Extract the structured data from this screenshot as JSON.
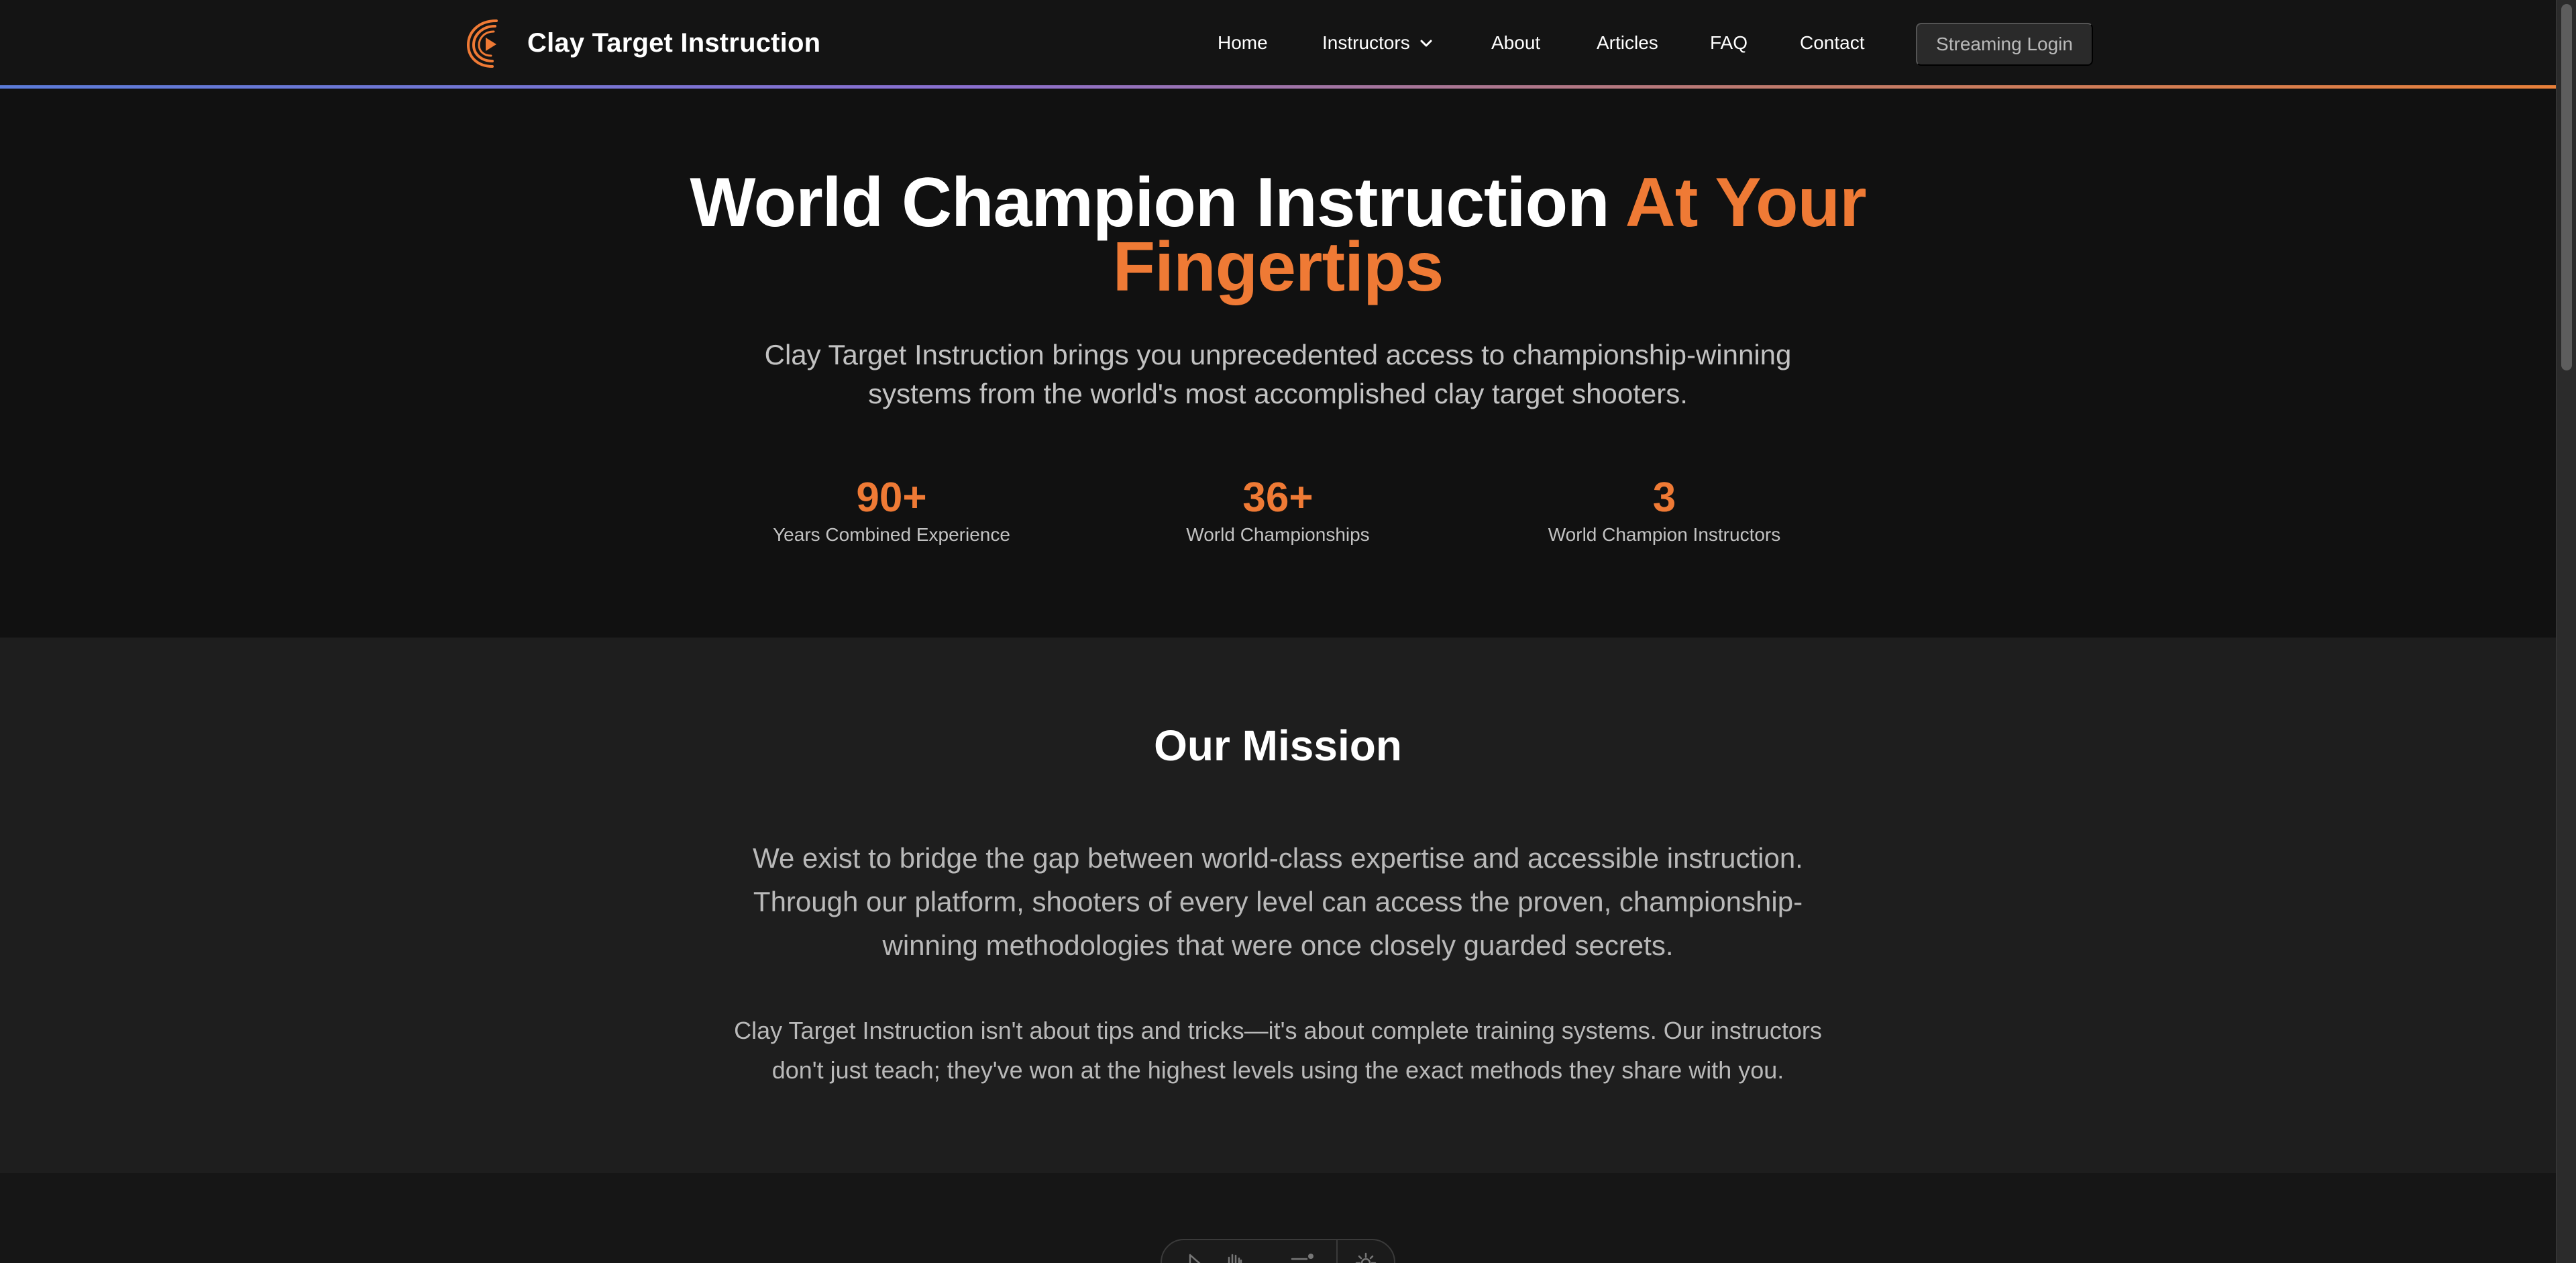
{
  "brand": {
    "name": "Clay Target Instruction",
    "logo_icon": "play-swoosh-logo",
    "accent_color": "#ef7a35"
  },
  "nav": {
    "items": [
      {
        "label": "Home"
      },
      {
        "label": "Instructors",
        "icon": "chevron-down-icon"
      },
      {
        "label": "About"
      },
      {
        "label": "Articles"
      },
      {
        "label": "FAQ"
      },
      {
        "label": "Contact"
      }
    ],
    "login_label": "Streaming Login"
  },
  "hero": {
    "title_white": "World Champion Instruction ",
    "title_orange_1": "At Your",
    "title_orange_2": "Fingertips",
    "subtitle": "Clay Target Instruction brings you unprecedented access to championship-winning systems from the world's most accomplished clay target shooters.",
    "stats": [
      {
        "value": "90+",
        "label": "Years Combined Experience"
      },
      {
        "value": "36+",
        "label": "World Championships"
      },
      {
        "value": "3",
        "label": "World Champion Instructors"
      }
    ]
  },
  "mission": {
    "title": "Our Mission",
    "paragraph_1": "We exist to bridge the gap between world-class expertise and accessible instruction. Through our platform, shooters of every level can access the proven, championship-winning methodologies that were once closely guarded secrets.",
    "paragraph_2": "Clay Target Instruction isn't about tips and tricks—it's about complete training systems. Our instructors don't just teach; they've won at the highest levels using the exact methods they share with you."
  },
  "toolbar": {
    "icons": [
      "pointer-icon",
      "hand-icon",
      "list-icon",
      "settings-icon"
    ]
  }
}
